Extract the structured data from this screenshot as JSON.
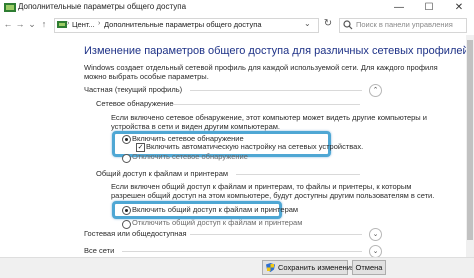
{
  "window": {
    "title": "Дополнительные параметры общего доступа",
    "minimize": "—",
    "maximize": "☐",
    "close": "✕"
  },
  "nav": {
    "back": "←",
    "forward": "→",
    "dropdown": "⌄",
    "up": "↑"
  },
  "address": {
    "separator": "›",
    "crumbs": [
      "Цент...",
      "Дополнительные параметры общего доступа"
    ],
    "search_placeholder": "Поиск в панели управления"
  },
  "main": {
    "heading": "Изменение параметров общего доступа для различных сетевых профилей",
    "description": [
      "Windows создает отдельный сетевой профиль для каждой используемой сети. Для каждого профиля",
      "можно выбрать особые параметры."
    ],
    "private_profile": {
      "title": "Частная (текущий профиль)",
      "network_discovery": {
        "title": "Сетевое обнаружение",
        "description": [
          "Если включено сетевое обнаружение, этот компьютер может видеть другие компьютеры и",
          "устройства в сети и виден другим компьютерам."
        ],
        "option_on": "Включить сетевое обнаружение",
        "auto_setup": "Включить автоматическую настройку на сетевых устройствах.",
        "option_off": "Отключить сетевое обнаружение"
      },
      "file_sharing": {
        "title": "Общий доступ к файлам и принтерам",
        "description": [
          "Если включен общий доступ к файлам и принтерам, то файлы и принтеры, к которым",
          "разрешен общий доступ на этом компьютере, будут доступны другим пользователям в сети."
        ],
        "option_on": "Включить общий доступ к файлам и принтерам",
        "option_off": "Отключить общий доступ к файлам и принтерам"
      }
    },
    "guest_profile": "Гостевая или общедоступная",
    "all_networks": "Все сети",
    "collapse_glyph": "⌃",
    "expand_glyph": "⌄"
  },
  "footer": {
    "save": "Сохранить изменения",
    "cancel": "Отмена"
  },
  "colors": {
    "heading": "#1e3287",
    "highlight": "#4fa7d4"
  }
}
